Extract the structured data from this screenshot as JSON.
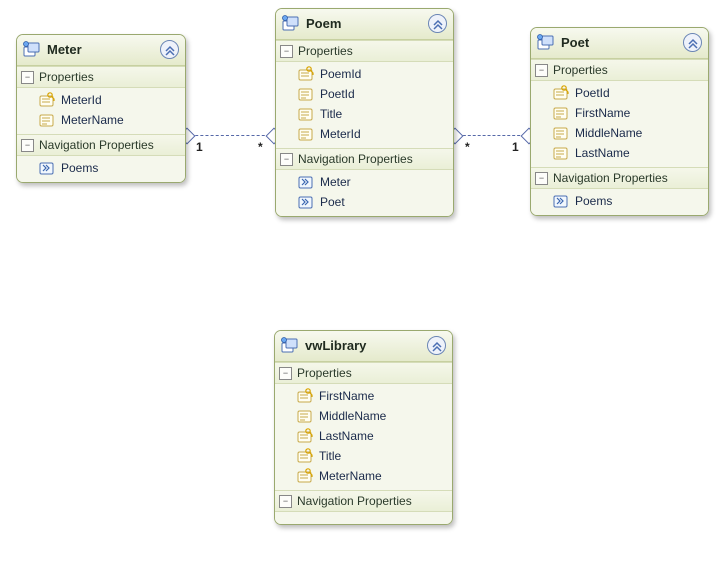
{
  "entities": {
    "meter": {
      "title": "Meter",
      "sections": {
        "props": {
          "label": "Properties",
          "items": [
            {
              "name": "MeterId",
              "icon": "key"
            },
            {
              "name": "MeterName",
              "icon": "prop"
            }
          ]
        },
        "nav": {
          "label": "Navigation Properties",
          "items": [
            {
              "name": "Poems",
              "icon": "nav"
            }
          ]
        }
      }
    },
    "poem": {
      "title": "Poem",
      "sections": {
        "props": {
          "label": "Properties",
          "items": [
            {
              "name": "PoemId",
              "icon": "key"
            },
            {
              "name": "PoetId",
              "icon": "prop"
            },
            {
              "name": "Title",
              "icon": "prop"
            },
            {
              "name": "MeterId",
              "icon": "prop"
            }
          ]
        },
        "nav": {
          "label": "Navigation Properties",
          "items": [
            {
              "name": "Meter",
              "icon": "nav"
            },
            {
              "name": "Poet",
              "icon": "nav"
            }
          ]
        }
      }
    },
    "poet": {
      "title": "Poet",
      "sections": {
        "props": {
          "label": "Properties",
          "items": [
            {
              "name": "PoetId",
              "icon": "key"
            },
            {
              "name": "FirstName",
              "icon": "prop"
            },
            {
              "name": "MiddleName",
              "icon": "prop"
            },
            {
              "name": "LastName",
              "icon": "prop"
            }
          ]
        },
        "nav": {
          "label": "Navigation Properties",
          "items": [
            {
              "name": "Poems",
              "icon": "nav"
            }
          ]
        }
      }
    },
    "vwlibrary": {
      "title": "vwLibrary",
      "sections": {
        "props": {
          "label": "Properties",
          "items": [
            {
              "name": "FirstName",
              "icon": "key"
            },
            {
              "name": "MiddleName",
              "icon": "prop"
            },
            {
              "name": "LastName",
              "icon": "key"
            },
            {
              "name": "Title",
              "icon": "key"
            },
            {
              "name": "MeterName",
              "icon": "key"
            }
          ]
        },
        "nav": {
          "label": "Navigation Properties",
          "items": []
        }
      }
    }
  },
  "relations": {
    "meter_poem": {
      "left": "1",
      "right": "*"
    },
    "poem_poet": {
      "left": "*",
      "right": "1"
    }
  }
}
